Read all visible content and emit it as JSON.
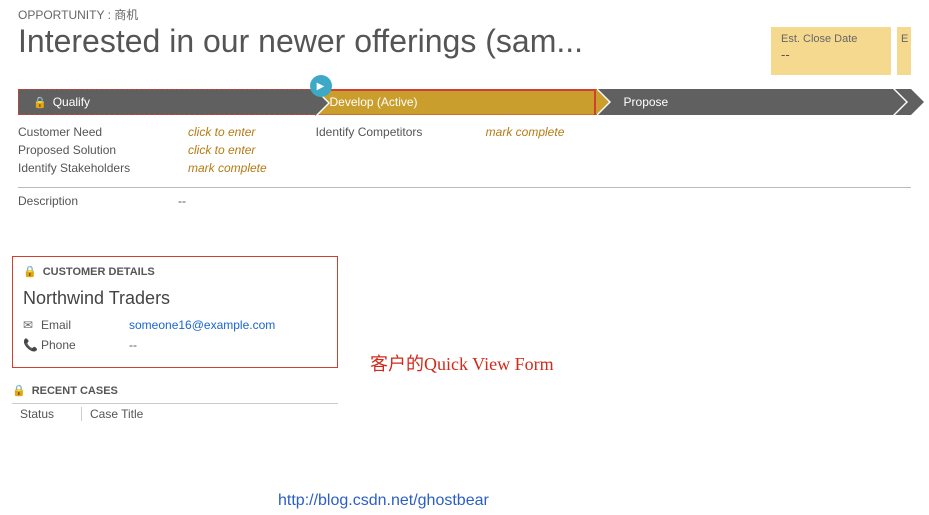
{
  "header": {
    "entity_label": "OPPORTUNITY : 商机",
    "title": "Interested in our newer offerings (sam..."
  },
  "close_box": {
    "label": "Est. Close Date",
    "value": "--",
    "label2": "E"
  },
  "stages": {
    "s1": "Qualify",
    "s2": "Develop (Active)",
    "s3": "Propose"
  },
  "qualify_fields": [
    {
      "label": "Customer Need",
      "value": "click to enter"
    },
    {
      "label": "Proposed Solution",
      "value": "click to enter"
    },
    {
      "label": "Identify Stakeholders",
      "value": "mark complete"
    }
  ],
  "develop_fields": [
    {
      "label": "Identify Competitors",
      "value": "mark complete"
    }
  ],
  "description": {
    "label": "Description",
    "value": "--"
  },
  "customer": {
    "section": "CUSTOMER DETAILS",
    "name": "Northwind Traders",
    "email_label": "Email",
    "email_value": "someone16@example.com",
    "phone_label": "Phone",
    "phone_value": "--"
  },
  "annotation": "客户的Quick View Form",
  "recent": {
    "section": "RECENT CASES",
    "col1": "Status",
    "col2": "Case Title"
  },
  "watermark": "http://blog.csdn.net/ghostbear"
}
